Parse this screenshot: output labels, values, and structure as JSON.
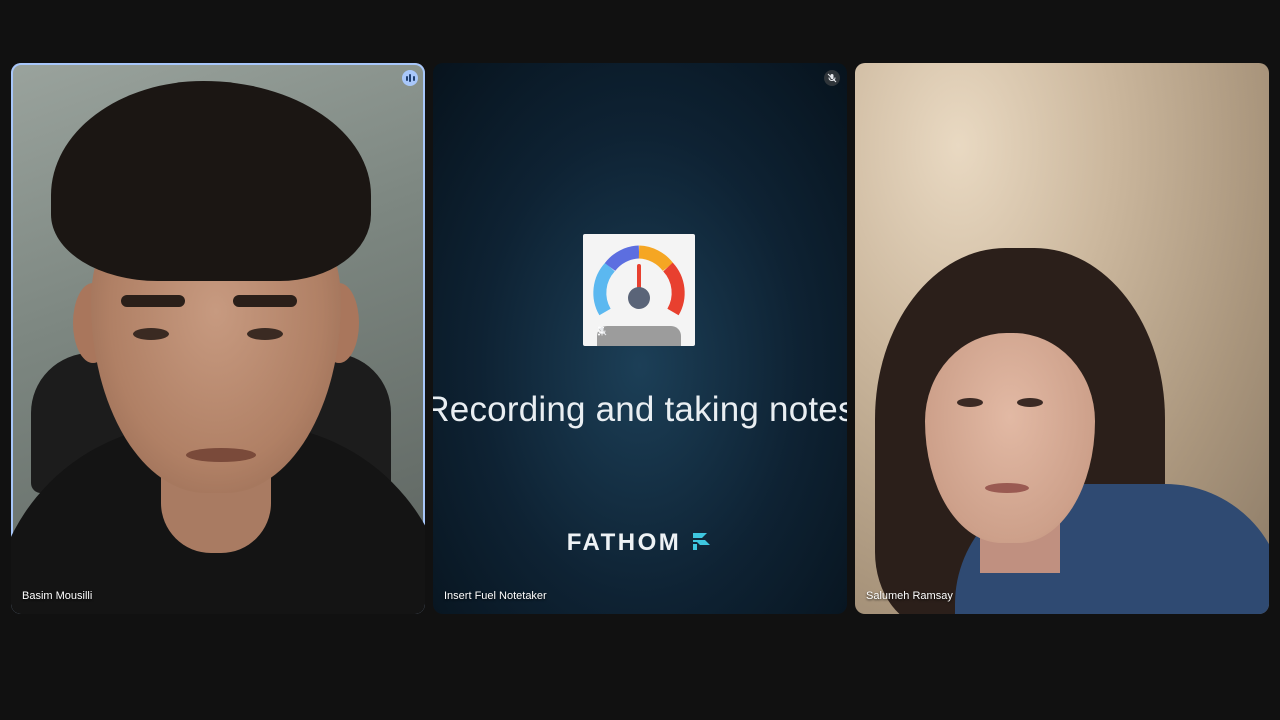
{
  "participants": [
    {
      "name": "Basim Mousilli",
      "speaking": true
    },
    {
      "name": "Insert Fuel Notetaker",
      "muted": true
    },
    {
      "name": "Salumeh Ramsay"
    }
  ],
  "notetaker": {
    "status_text": "Recording and taking notes",
    "brand": "FATHOM",
    "tile_controls": [
      "pin-icon",
      "mic-off-icon",
      "more-vert-icon"
    ]
  },
  "colors": {
    "background": "#111111",
    "active_speaker_border": "#a8c7fa",
    "brand_accent": "#3ec7e0"
  }
}
